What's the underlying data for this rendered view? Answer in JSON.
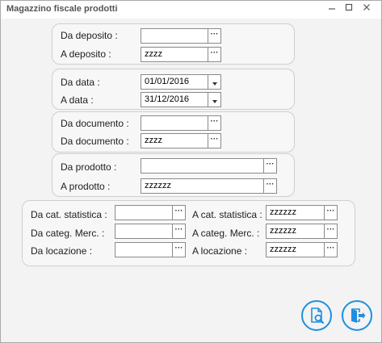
{
  "window": {
    "title": "Magazzino fiscale prodotti"
  },
  "deposito": {
    "from_label": "Da deposito  :",
    "from_value": "",
    "to_label": "A deposito   :",
    "to_value": "zzzz"
  },
  "data": {
    "from_label": "Da data  :",
    "from_value": "01/01/2016",
    "to_label": "A data  :",
    "to_value": "31/12/2016"
  },
  "documento": {
    "from_label": "Da documento  :",
    "from_value": "",
    "to_label": "Da documento  :",
    "to_value": "zzzz"
  },
  "prodotto": {
    "from_label": "Da prodotto  :",
    "from_value": "",
    "to_label": "A prodotto  :",
    "to_value": "zzzzzz"
  },
  "extra": {
    "cat_from_label": "Da cat. statistica  :",
    "cat_from_value": "",
    "cat_to_label": "A cat. statistica  :",
    "cat_to_value": "zzzzzz",
    "merc_from_label": "Da categ. Merc.  :",
    "merc_from_value": "",
    "merc_to_label": "A categ. Merc.  :",
    "merc_to_value": "zzzzzz",
    "loc_from_label": "Da locazione  :",
    "loc_from_value": "",
    "loc_to_label": "A locazione  :",
    "loc_to_value": "zzzzzz"
  },
  "buttons": {
    "ellipsis": "···",
    "preview_icon": "document-search-icon",
    "exit_icon": "exit-door-icon",
    "minimize_icon": "minimize-icon",
    "maximize_icon": "maximize-icon",
    "close_icon": "close-icon"
  }
}
